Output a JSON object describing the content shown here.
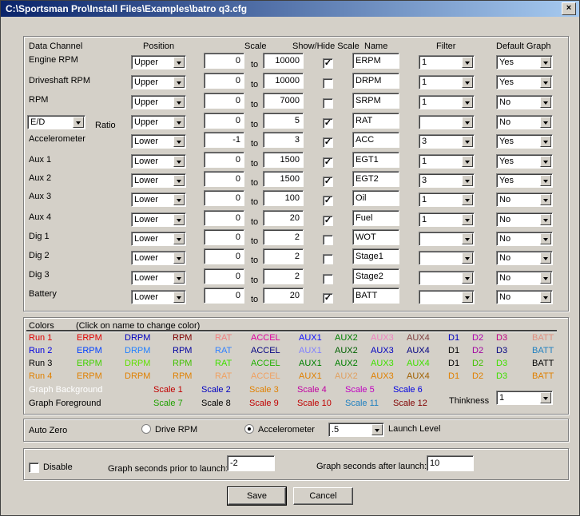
{
  "title": "C:\\Sportsman Pro\\Install Files\\Examples\\batro q3.cfg",
  "headers": {
    "data_channel": "Data Channel",
    "position": "Position",
    "scale": "Scale",
    "show_hide": "Show/Hide Scale",
    "name": "Name",
    "filter": "Filter",
    "default_graph": "Default Graph"
  },
  "to_label": "to",
  "ratio_label": "Ratio",
  "channels": [
    {
      "label": "Engine RPM",
      "position": "Upper",
      "min": "0",
      "max": "10000",
      "show": true,
      "name": "ERPM",
      "filter": "1",
      "graph": "Yes"
    },
    {
      "label": "Driveshaft RPM",
      "position": "Upper",
      "min": "0",
      "max": "10000",
      "show": false,
      "name": "DRPM",
      "filter": "1",
      "graph": "Yes"
    },
    {
      "label": "RPM",
      "position": "Upper",
      "min": "0",
      "max": "7000",
      "show": false,
      "name": "SRPM",
      "filter": "1",
      "graph": "No"
    },
    {
      "label": "E/D",
      "position": "Upper",
      "min": "0",
      "max": "5",
      "show": true,
      "name": "RAT",
      "filter": "",
      "graph": "No"
    },
    {
      "label": "Accelerometer",
      "position": "Lower",
      "min": "-1",
      "max": "3",
      "show": true,
      "name": "ACC",
      "filter": "3",
      "graph": "Yes"
    },
    {
      "label": "Aux 1",
      "position": "Lower",
      "min": "0",
      "max": "1500",
      "show": true,
      "name": "EGT1",
      "filter": "1",
      "graph": "Yes"
    },
    {
      "label": "Aux 2",
      "position": "Lower",
      "min": "0",
      "max": "1500",
      "show": true,
      "name": "EGT2",
      "filter": "3",
      "graph": "Yes"
    },
    {
      "label": "Aux 3",
      "position": "Lower",
      "min": "0",
      "max": "100",
      "show": true,
      "name": "Oil",
      "filter": "1",
      "graph": "No"
    },
    {
      "label": "Aux 4",
      "position": "Lower",
      "min": "0",
      "max": "20",
      "show": true,
      "name": "Fuel",
      "filter": "1",
      "graph": "No"
    },
    {
      "label": "Dig 1",
      "position": "Lower",
      "min": "0",
      "max": "2",
      "show": false,
      "name": "WOT",
      "filter": "",
      "graph": "No"
    },
    {
      "label": "Dig 2",
      "position": "Lower",
      "min": "0",
      "max": "2",
      "show": false,
      "name": "Stage1",
      "filter": "",
      "graph": "No"
    },
    {
      "label": "Dig 3",
      "position": "Lower",
      "min": "0",
      "max": "2",
      "show": false,
      "name": "Stage2",
      "filter": "",
      "graph": "No"
    },
    {
      "label": "Battery",
      "position": "Lower",
      "min": "0",
      "max": "20",
      "show": true,
      "name": "BATT",
      "filter": "",
      "graph": "No"
    }
  ],
  "colors": {
    "heading": "Colors",
    "hint": "(Click on name to change color)",
    "columns": [
      "ERPM",
      "DRPM",
      "RPM",
      "RAT",
      "ACCEL",
      "AUX1",
      "AUX2",
      "AUX3",
      "AUX4",
      "D1",
      "D2",
      "D3",
      "BATT"
    ],
    "runs": [
      {
        "label": "Run 1",
        "colors": [
          "#e00000",
          "#e00000",
          "#0000c0",
          "#800000",
          "#f08080",
          "#e000a0",
          "#1010ff",
          "#008000",
          "#f080c0",
          "#804040",
          "#0000c0",
          "#b000b0",
          "#c00080",
          "#e09080"
        ]
      },
      {
        "label": "Run 2",
        "colors": [
          "#0000e0",
          "#0040ff",
          "#2080ff",
          "#0000a0",
          "#3080ff",
          "#000080",
          "#8080ff",
          "#006000",
          "#0000c0",
          "#000080",
          "#000000",
          "#a000a0",
          "#000080",
          "#2080c0"
        ]
      },
      {
        "label": "Run 3",
        "colors": [
          "#000000",
          "#40d000",
          "#60e000",
          "#40c000",
          "#40e000",
          "#20b000",
          "#008000",
          "#008000",
          "#40e000",
          "#40e000",
          "#000000",
          "#40c000",
          "#40e000",
          "#000000"
        ]
      },
      {
        "label": "Run 4",
        "colors": [
          "#e08000",
          "#e08000",
          "#e08000",
          "#e08000",
          "#f0a060",
          "#f0a060",
          "#e08000",
          "#e0a060",
          "#e08000",
          "#a06000",
          "#e08000",
          "#e08000",
          "#40e000",
          "#e08000"
        ]
      }
    ],
    "graph_background": "Graph Background",
    "graph_foreground": "Graph Foreground",
    "scales_row1": [
      {
        "label": "Scale 1",
        "color": "#c00000"
      },
      {
        "label": "Scale 2",
        "color": "#0000c0"
      },
      {
        "label": "Scale 3",
        "color": "#e08000"
      },
      {
        "label": "Scale 4",
        "color": "#c000a0"
      },
      {
        "label": "Scale 5",
        "color": "#c000c0"
      },
      {
        "label": "Scale 6",
        "color": "#0000e0"
      }
    ],
    "scales_row2": [
      {
        "label": "Scale 7",
        "color": "#20a000"
      },
      {
        "label": "Scale 8",
        "color": "#000000"
      },
      {
        "label": "Scale 9",
        "color": "#c00000"
      },
      {
        "label": "Scale 10",
        "color": "#c00000"
      },
      {
        "label": "Scale 11",
        "color": "#2080c0"
      },
      {
        "label": "Scale 12",
        "color": "#800000"
      }
    ],
    "thinkness_label": "Thinkness",
    "thinkness_value": "1"
  },
  "autozero": {
    "label": "Auto Zero",
    "option1": "Drive RPM",
    "option2": "Accelerometer",
    "selected": "Accelerometer",
    "level_value": ".5",
    "level_label": "Launch Level"
  },
  "launch": {
    "disable_label": "Disable",
    "disabled": false,
    "prior_label": "Graph seconds prior to launch:",
    "prior_value": "-2",
    "after_label": "Graph seconds after launch:",
    "after_value": "10"
  },
  "buttons": {
    "save": "Save",
    "cancel": "Cancel"
  }
}
